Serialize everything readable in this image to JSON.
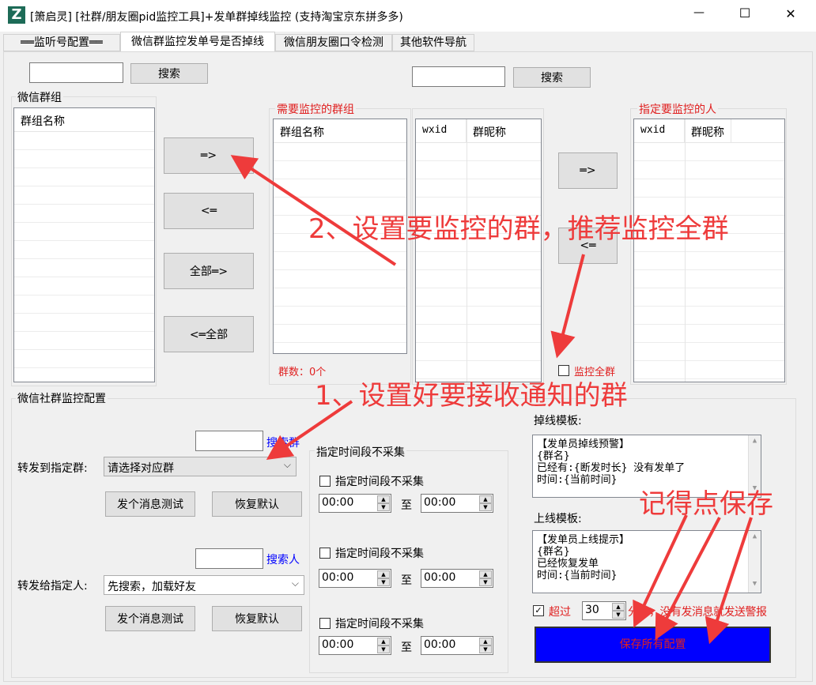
{
  "window": {
    "title": "[箫启灵] [社群/朋友圈pid监控工具]+发单群掉线监控 (支持淘宝京东拼多多)",
    "logo_letter": "Z",
    "minimize": "—",
    "maximize": "☐",
    "close": "✕"
  },
  "tabs": [
    {
      "label": "══监听号配置══",
      "active": false
    },
    {
      "label": "微信群监控发单号是否掉线",
      "active": true
    },
    {
      "label": "微信朋友圈口令检测",
      "active": false
    },
    {
      "label": "其他软件导航",
      "active": false
    }
  ],
  "top": {
    "search_left": {
      "value": "",
      "button": "搜索"
    },
    "search_right": {
      "value": "",
      "button": "搜索"
    }
  },
  "wechat_groups": {
    "caption": "微信群组",
    "column": "群组名称"
  },
  "transfer_buttons": {
    "add": "═>",
    "remove": "<═",
    "add_all": "全部═>",
    "remove_all": "<═全部"
  },
  "monitored_groups": {
    "caption": "需要监控的群组",
    "column": "群组名称",
    "count_label": "群数：0个"
  },
  "members": {
    "col_wxid": "wxid",
    "col_nick": "群昵称"
  },
  "people_buttons": {
    "add": "═>",
    "remove": "<═"
  },
  "target_people": {
    "caption": "指定要监控的人",
    "col_wxid": "wxid",
    "col_nick": "群昵称"
  },
  "monitor_all": {
    "label": "监控全群",
    "checked": false
  },
  "config": {
    "caption": "微信社群监控配置",
    "forward_group": {
      "search_value": "",
      "search_link": "搜索群",
      "label": "转发到指定群:",
      "selected": "请选择对应群",
      "test_button": "发个消息测试",
      "reset_button": "恢复默认"
    },
    "forward_person": {
      "search_value": "",
      "search_link": "搜索人",
      "label": "转发给指定人:",
      "selected": "先搜索，加载好友",
      "test_button": "发个消息测试",
      "reset_button": "恢复默认"
    }
  },
  "time_ranges": {
    "caption": "指定时间段不采集",
    "to_label": "至",
    "items": [
      {
        "label": "指定时间段不采集",
        "checked": false,
        "from": "00:00",
        "to": "00:00"
      },
      {
        "label": "指定时间段不采集",
        "checked": false,
        "from": "00:00",
        "to": "00:00"
      },
      {
        "label": "指定时间段不采集",
        "checked": false,
        "from": "00:00",
        "to": "00:00"
      }
    ]
  },
  "offline_template": {
    "label": "掉线模板:",
    "text": "【发单员掉线预警】\n{群名}\n已经有:{断发时长} 没有发单了\n时间:{当前时间}"
  },
  "online_template": {
    "label": "上线模板:",
    "text": "【发单员上线提示】\n{群名}\n已经恢复发单\n时间:{当前时间}"
  },
  "alert": {
    "checked": true,
    "label_prefix": "超过",
    "minutes": "30",
    "label_suffix": "分钟，没有发消息就发送警报"
  },
  "save_button": "保存所有配置",
  "annotations": {
    "step2": "2、设置要监控的群，推荐监控全群",
    "step1": "1、设置好要接收通知的群",
    "save_reminder": "记得点保存"
  },
  "colors": {
    "accent_red": "#e02020",
    "link_blue": "#0000ff",
    "save_bg": "#0000ff",
    "annotation_red": "#ee3b3b"
  }
}
